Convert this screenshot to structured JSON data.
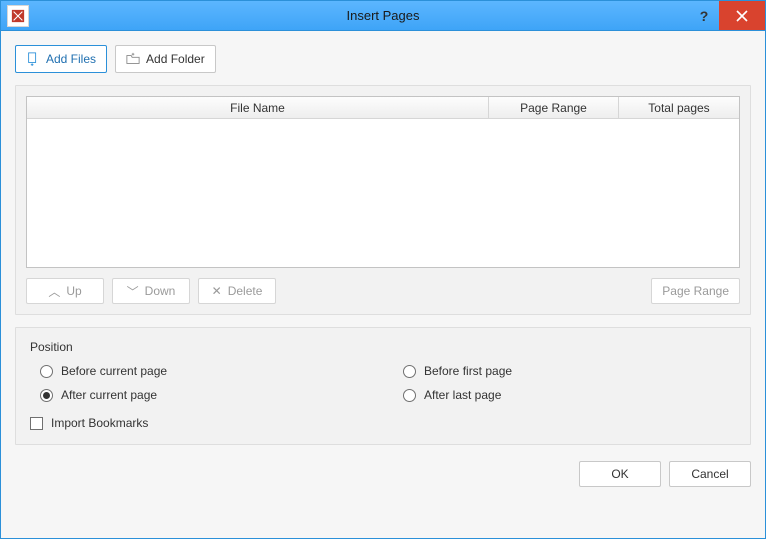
{
  "window": {
    "title": "Insert Pages"
  },
  "toolbar": {
    "add_files": "Add Files",
    "add_folder": "Add Folder"
  },
  "table": {
    "headers": {
      "filename": "File Name",
      "page_range": "Page Range",
      "total_pages": "Total pages"
    },
    "rows": []
  },
  "file_actions": {
    "up": "Up",
    "down": "Down",
    "delete": "Delete",
    "page_range": "Page Range"
  },
  "position": {
    "legend": "Position",
    "options": {
      "before_current": "Before current page",
      "after_current": "After current page",
      "before_first": "Before first page",
      "after_last": "After last page"
    },
    "selected": "after_current"
  },
  "import_bookmarks": {
    "label": "Import Bookmarks",
    "checked": false
  },
  "footer": {
    "ok": "OK",
    "cancel": "Cancel"
  }
}
